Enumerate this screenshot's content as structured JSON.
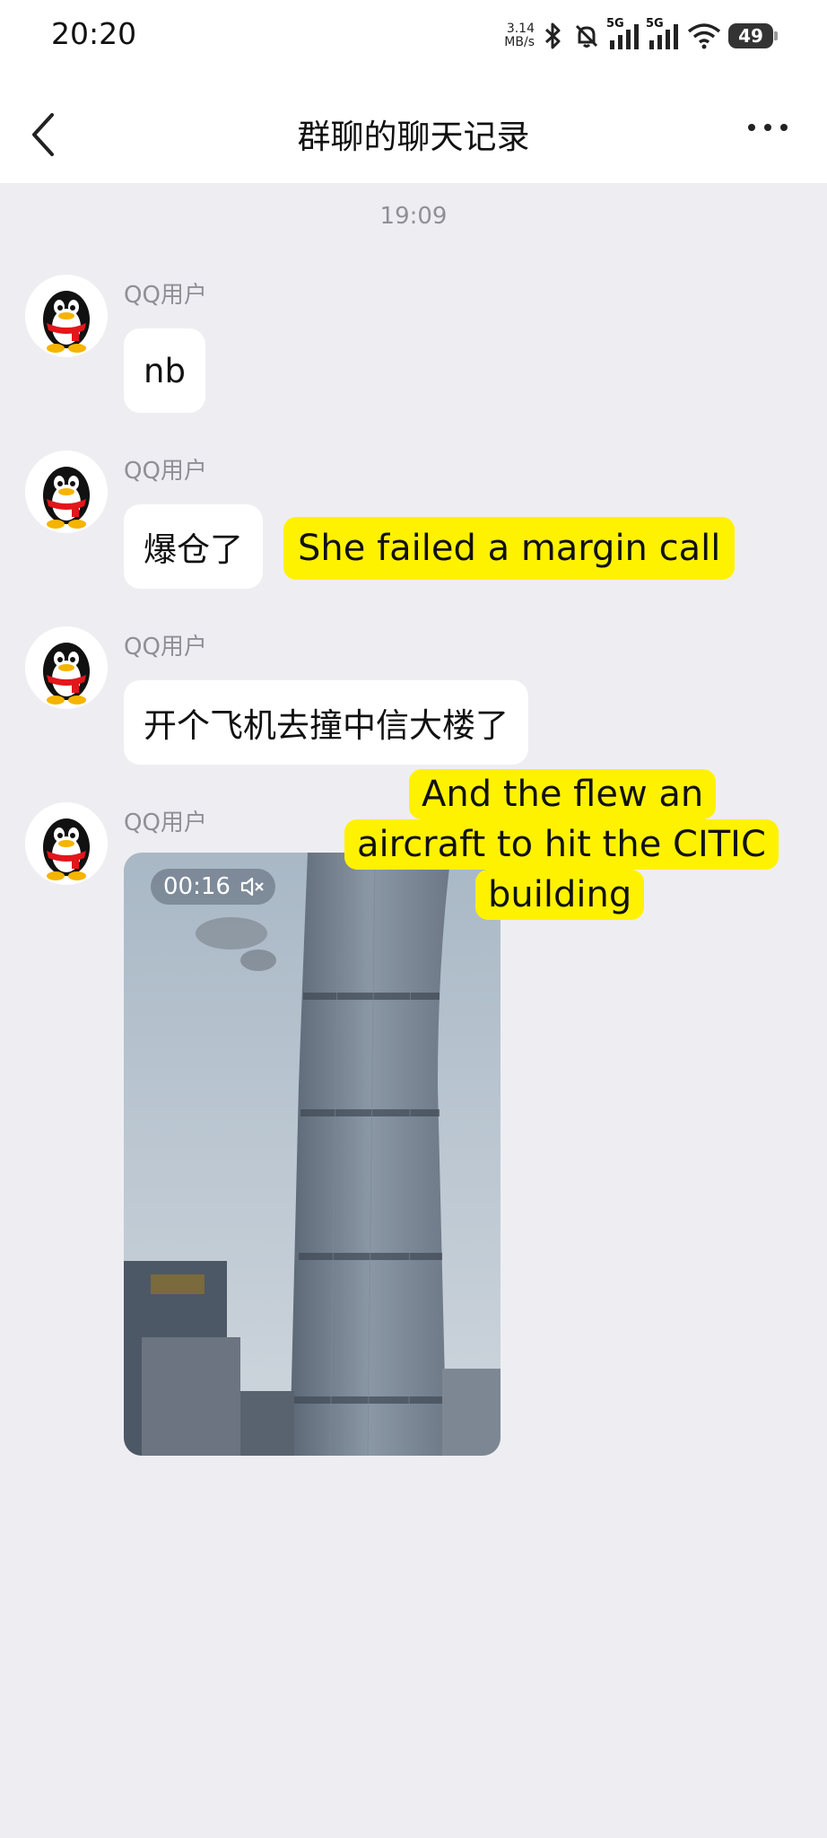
{
  "status_bar": {
    "time": "20:20",
    "net_speed_value": "3.14",
    "net_speed_unit": "MB/s",
    "signal_1": "5G",
    "signal_2": "5G",
    "battery": "49",
    "icons": [
      "bluetooth-icon",
      "mute-icon",
      "signal-icon",
      "signal-icon",
      "wifi-icon",
      "battery-icon"
    ]
  },
  "nav": {
    "title": "群聊的聊天记录",
    "back_icon": "chevron-left-icon",
    "more_icon": "more-dots-icon"
  },
  "chat": {
    "timestamp": "19:09",
    "messages": [
      {
        "sender": "QQ用户",
        "text": "nb"
      },
      {
        "sender": "QQ用户",
        "text": "爆仓了",
        "caption": "She failed a margin call"
      },
      {
        "sender": "QQ用户",
        "text": "开个飞机去撞中信大楼了"
      },
      {
        "sender": "QQ用户",
        "video_duration": "00:16",
        "caption_lines": [
          "And the flew an",
          "aircraft to hit the CITIC",
          "building"
        ]
      }
    ]
  },
  "colors": {
    "background": "#eeeef2",
    "bubble": "#ffffff",
    "caption_highlight": "#fff200",
    "meta_text": "#8f8f96"
  }
}
